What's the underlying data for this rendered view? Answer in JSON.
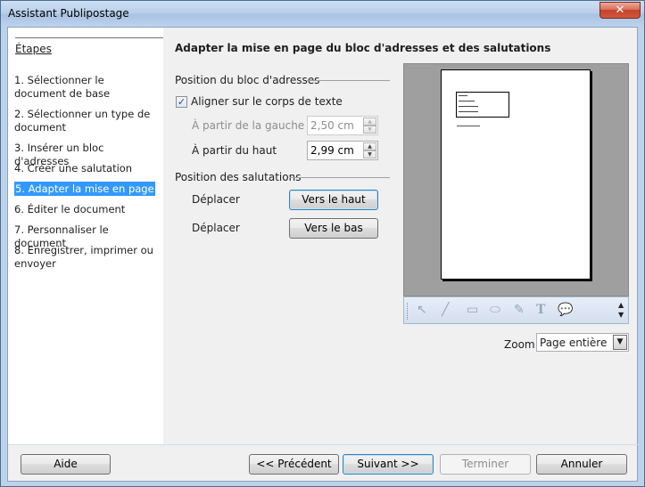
{
  "window": {
    "title": "Assistant Publipostage",
    "close_glyph": "✕"
  },
  "steps": {
    "title": "Étapes",
    "items": [
      {
        "num": "1.",
        "label": "Sélectionner le document de base"
      },
      {
        "num": "2.",
        "label": "Sélectionner un type de document"
      },
      {
        "num": "3.",
        "label": "Insérer un bloc d'adresses"
      },
      {
        "num": "4.",
        "label": "Créer une salutation"
      },
      {
        "num": "5.",
        "label": "Adapter la mise en page"
      },
      {
        "num": "6.",
        "label": "Éditer le document"
      },
      {
        "num": "7.",
        "label": "Personnaliser le document"
      },
      {
        "num": "8.",
        "label": "Enregistrer, imprimer ou envoyer"
      }
    ],
    "active_index": 4
  },
  "main": {
    "heading": "Adapter la mise en page du bloc d'adresses et des salutations",
    "address_section": {
      "label": "Position du bloc d'adresses",
      "align_checkbox": {
        "label": "Aligner sur le corps de texte",
        "checked": true,
        "check_glyph": "✓"
      },
      "from_left": {
        "label": "À partir de la gauche",
        "value": "2,50 cm",
        "enabled": false
      },
      "from_top": {
        "label": "À partir du haut",
        "value": "2,99 cm",
        "enabled": true
      }
    },
    "salutation_section": {
      "label": "Position des salutations",
      "move_up": {
        "label": "Déplacer",
        "button": "Vers le haut"
      },
      "move_down": {
        "label": "Déplacer",
        "button": "Vers le bas"
      }
    }
  },
  "preview": {
    "toolbar_icons": [
      "cursor-icon",
      "line-icon",
      "rectangle-icon",
      "ellipse-icon",
      "pen-icon",
      "text-icon",
      "callout-icon"
    ]
  },
  "zoom": {
    "label": "Zoom",
    "value": "Page entière"
  },
  "footer": {
    "help": "Aide",
    "previous": "<< Précédent",
    "next": "Suivant >>",
    "finish": "Terminer",
    "cancel": "Annuler"
  },
  "colors": {
    "selection": "#3399ff",
    "window_frame": "#bcd3ea",
    "close_button": "#c4432b"
  }
}
